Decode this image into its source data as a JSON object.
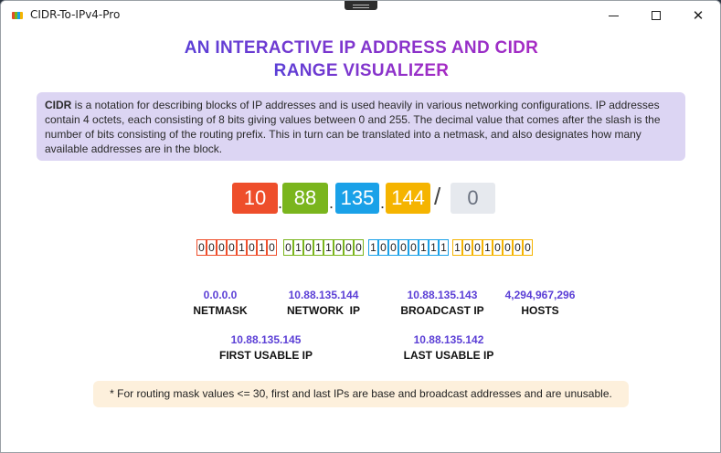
{
  "window": {
    "title": "CIDR-To-IPv4-Pro",
    "minimize": "minimize",
    "maximize": "maximize",
    "close": "close"
  },
  "header": {
    "line1": "AN INTERACTIVE IP ADDRESS AND CIDR",
    "line2": "RANGE VISUALIZER"
  },
  "info": {
    "term": "CIDR",
    "text": " is a notation for describing blocks of IP addresses and is used heavily in various networking configurations. IP addresses contain 4 octets, each consisting of 8 bits giving values between 0 and 255. The decimal value that comes after the slash is the number of bits consisting of the routing prefix. This in turn can be translated into a netmask, and also designates how many available addresses are in the block."
  },
  "ip": {
    "octets": [
      "10",
      "88",
      "135",
      "144"
    ],
    "mask": "0",
    "octet_colors": [
      "#ee4e2b",
      "#7ab51d",
      "#1aa1e8",
      "#f5b400"
    ]
  },
  "binary": [
    [
      "0",
      "0",
      "0",
      "0",
      "1",
      "0",
      "1",
      "0"
    ],
    [
      "0",
      "1",
      "0",
      "1",
      "1",
      "0",
      "0",
      "0"
    ],
    [
      "1",
      "0",
      "0",
      "0",
      "0",
      "1",
      "1",
      "1"
    ],
    [
      "1",
      "0",
      "0",
      "1",
      "0",
      "0",
      "0",
      "0"
    ]
  ],
  "stats": {
    "netmask": {
      "value": "0.0.0.0",
      "label": "NETMASK"
    },
    "network": {
      "value": "10.88.135.144",
      "label": "NETWORK  IP"
    },
    "broadcast": {
      "value": "10.88.135.143",
      "label": "BROADCAST IP"
    },
    "hosts": {
      "value": "4,294,967,296",
      "label": "HOSTS"
    },
    "first": {
      "value": "10.88.135.145",
      "label": "FIRST USABLE IP"
    },
    "last": {
      "value": "10.88.135.142",
      "label": "LAST USABLE IP"
    }
  },
  "note": "* For routing mask values <= 30, first and last IPs are base and broadcast addresses and are unusable."
}
